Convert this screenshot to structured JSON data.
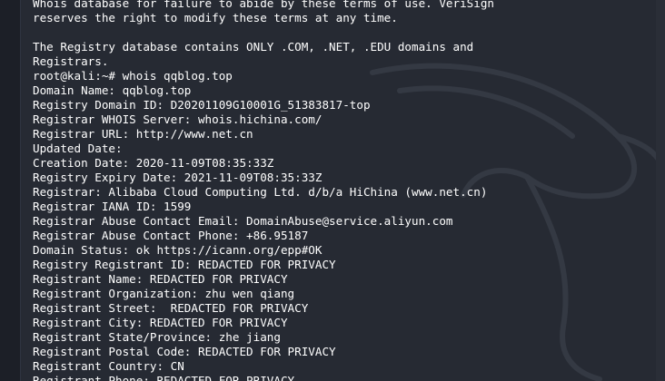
{
  "terminal": {
    "lines": [
      "Whois database for failure to abide by these terms of use. VeriSign",
      "reserves the right to modify these terms at any time.",
      "",
      "The Registry database contains ONLY .COM, .NET, .EDU domains and",
      "Registrars.",
      "root@kali:~# whois qqblog.top",
      "Domain Name: qqblog.top",
      "Registry Domain ID: D20201109G10001G_51383817-top",
      "Registrar WHOIS Server: whois.hichina.com/",
      "Registrar URL: http://www.net.cn",
      "Updated Date:",
      "Creation Date: 2020-11-09T08:35:33Z",
      "Registry Expiry Date: 2021-11-09T08:35:33Z",
      "Registrar: Alibaba Cloud Computing Ltd. d/b/a HiChina (www.net.cn)",
      "Registrar IANA ID: 1599",
      "Registrar Abuse Contact Email: DomainAbuse@service.aliyun.com",
      "Registrar Abuse Contact Phone: +86.95187",
      "Domain Status: ok https://icann.org/epp#OK",
      "Registry Registrant ID: REDACTED FOR PRIVACY",
      "Registrant Name: REDACTED FOR PRIVACY",
      "Registrant Organization: zhu wen qiang",
      "Registrant Street:  REDACTED FOR PRIVACY",
      "Registrant City: REDACTED FOR PRIVACY",
      "Registrant State/Province: zhe jiang",
      "Registrant Postal Code: REDACTED FOR PRIVACY",
      "Registrant Country: CN",
      "Registrant Phone: REDACTED FOR PRIVACY"
    ]
  },
  "theme": {
    "background": "#262a33",
    "text": "#ffffff"
  },
  "icons": {
    "watermark": "kali-dragon-icon"
  }
}
